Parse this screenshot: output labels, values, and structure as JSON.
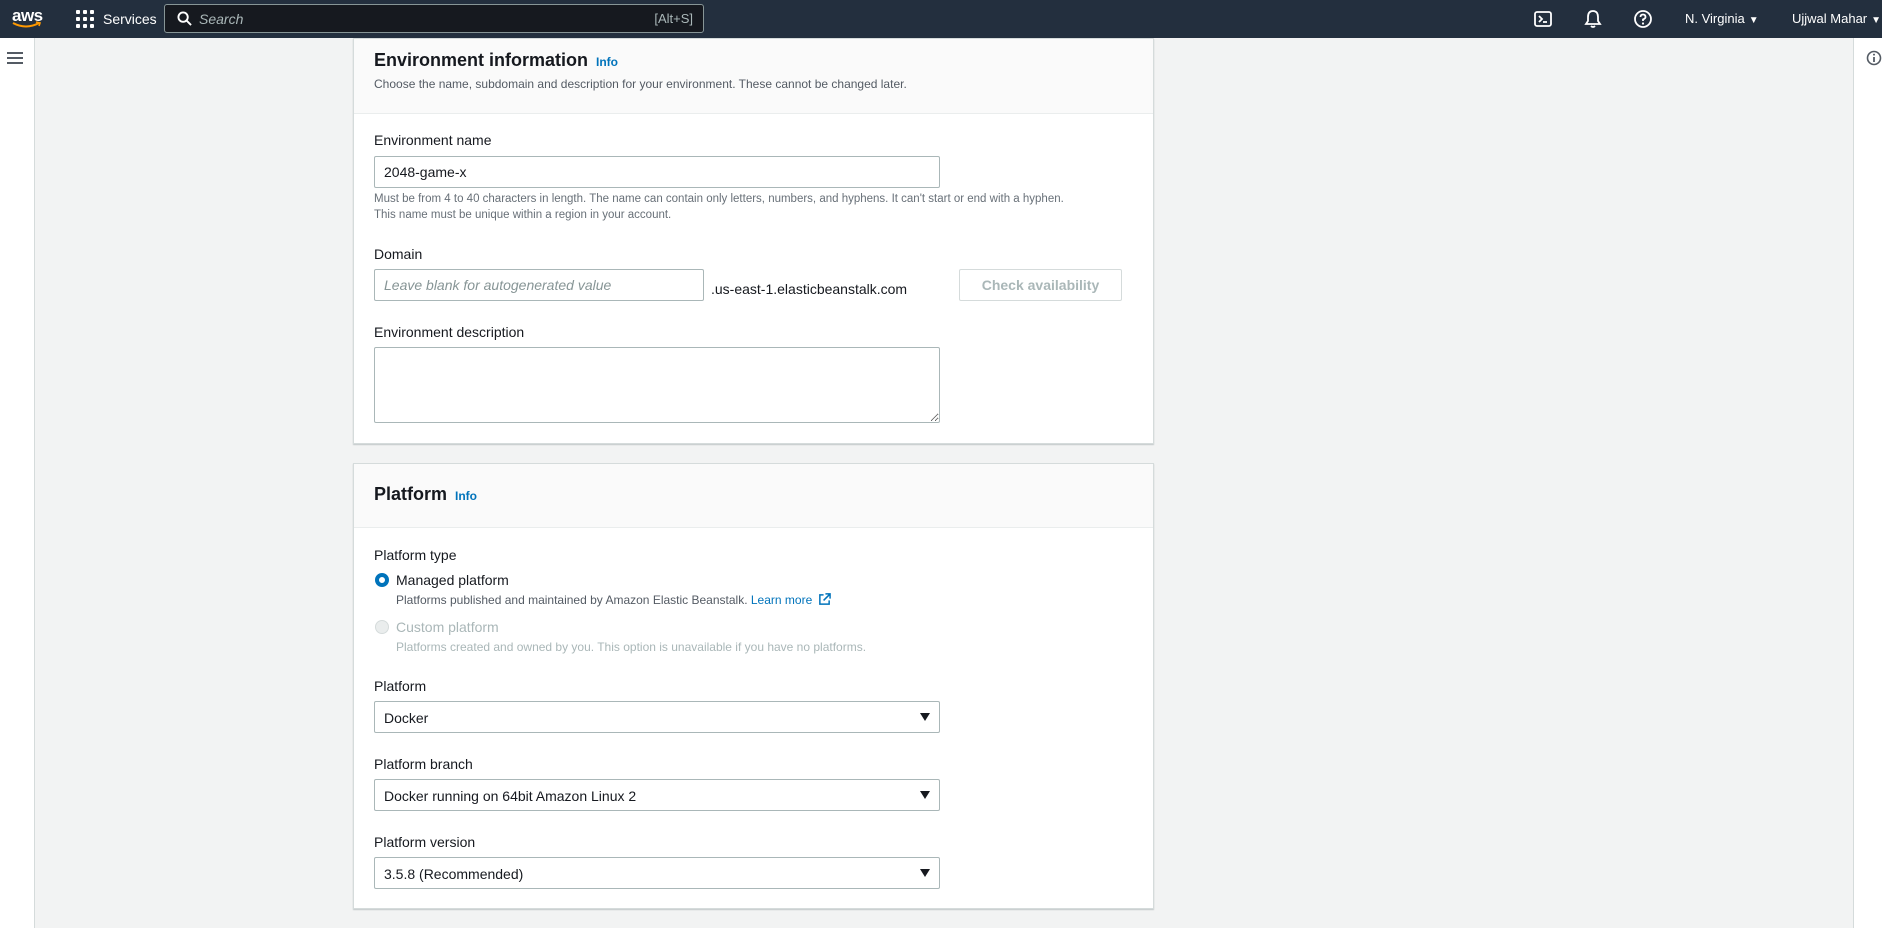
{
  "topnav": {
    "logo_text": "aws",
    "services_label": "Services",
    "search_placeholder": "Search",
    "search_shortcut": "[Alt+S]",
    "region": "N. Virginia",
    "user": "Ujjwal Mahar"
  },
  "environment_info": {
    "title": "Environment information",
    "info_link": "Info",
    "description": "Choose the name, subdomain and description for your environment. These cannot be changed later.",
    "name_label": "Environment name",
    "name_value": "2048-game-x",
    "name_hint_line1": "Must be from 4 to 40 characters in length. The name can contain only letters, numbers, and hyphens. It can't start or end with a hyphen.",
    "name_hint_line2": "This name must be unique within a region in your account.",
    "domain_label": "Domain",
    "domain_placeholder": "Leave blank for autogenerated value",
    "domain_suffix": ".us-east-1.elasticbeanstalk.com",
    "check_button": "Check availability",
    "description_label": "Environment description",
    "description_value": ""
  },
  "platform": {
    "title": "Platform",
    "info_link": "Info",
    "type_label": "Platform type",
    "managed_label": "Managed platform",
    "managed_desc": "Platforms published and maintained by Amazon Elastic Beanstalk.",
    "learn_more": "Learn more",
    "custom_label": "Custom platform",
    "custom_desc": "Platforms created and owned by you. This option is unavailable if you have no platforms.",
    "platform_label": "Platform",
    "platform_value": "Docker",
    "branch_label": "Platform branch",
    "branch_value": "Docker running on 64bit Amazon Linux 2",
    "version_label": "Platform version",
    "version_value": "3.5.8 (Recommended)",
    "selected_type": "managed"
  },
  "colors": {
    "nav_bg": "#232f3e",
    "accent": "#0073bb",
    "page_bg": "#f2f3f3"
  }
}
